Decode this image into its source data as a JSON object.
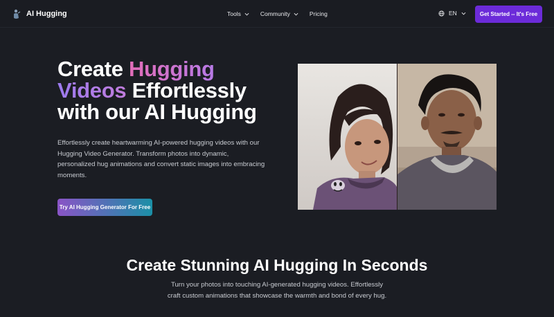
{
  "nav": {
    "brand": "AI Hugging",
    "links": [
      {
        "label": "Tools",
        "has_dropdown": true
      },
      {
        "label": "Community",
        "has_dropdown": true
      },
      {
        "label": "Pricing",
        "has_dropdown": false
      }
    ],
    "language": "EN",
    "cta": "Get Started -- It's Free"
  },
  "hero": {
    "title_word1": "Create ",
    "title_highlight1": "Hugging",
    "title_highlight2": "Videos",
    "title_rest": " Effortlessly with our AI Hugging",
    "description": "Effortlessly create heartwarming AI-powered hugging videos with our Hugging Video Generator. Transform photos into dynamic, personalized hug animations and convert static images into embracing moments.",
    "cta": "Try AI Hugging Generator For Free"
  },
  "section2": {
    "title": "Create Stunning AI Hugging In Seconds",
    "description": "Turn your photos into touching AI-generated hugging videos. Effortlessly craft custom animations that showcase the warmth and bond of every hug."
  },
  "colors": {
    "background": "#1b1d23",
    "accent_purple": "#6c2bd9",
    "gradient_start": "#8a54c6",
    "gradient_end": "#1b8fa6",
    "highlight_pink": "#e26db8",
    "highlight_violet": "#9c7bf0"
  },
  "icons": [
    "logo-icon",
    "chevron-down-icon",
    "globe-icon"
  ]
}
